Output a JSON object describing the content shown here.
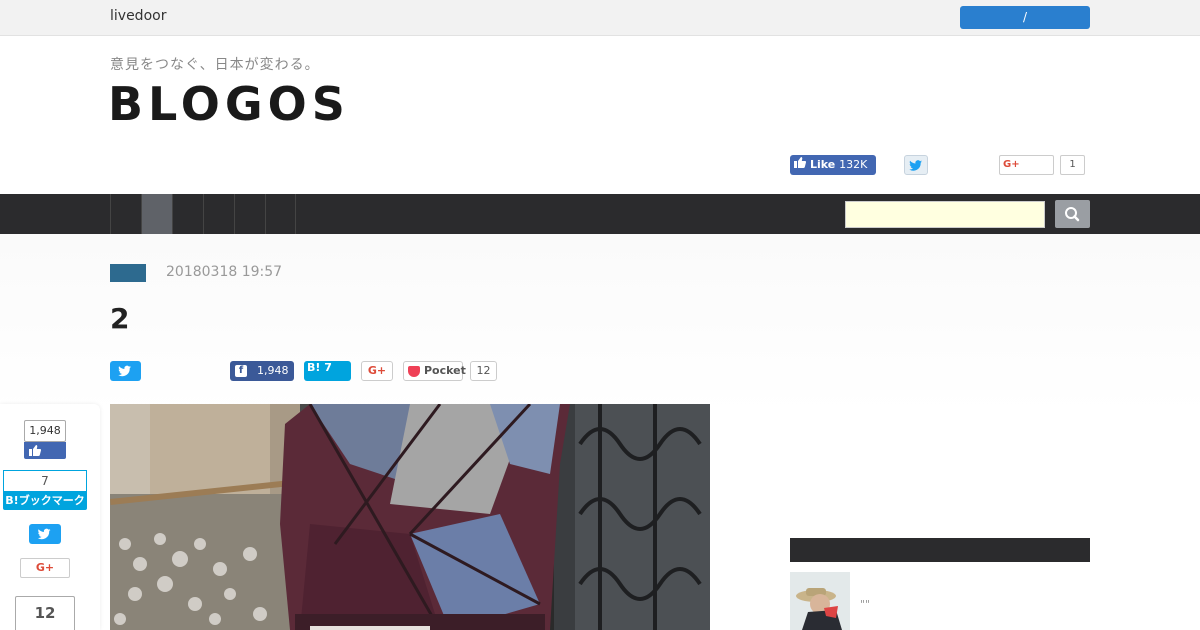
{
  "topbar": {
    "brand": "livedoor",
    "login_label": "/"
  },
  "header": {
    "tagline": "意見をつなぐ、日本が変わる。",
    "logo": "BLOGOS",
    "fb_like_label": "Like",
    "fb_like_count": "132K",
    "gplus_label": "G+",
    "gplus_count": "1"
  },
  "nav": {
    "items": [
      "",
      "",
      "",
      "",
      "",
      ""
    ],
    "active_index": 1
  },
  "search": {
    "placeholder": "",
    "button_icon": "search-icon"
  },
  "article": {
    "date": "20180318 19:57",
    "title": "2",
    "share": {
      "facebook_count": "1,948",
      "hatena_label": "B!",
      "hatena_count": "7",
      "gplus_label": "G+",
      "pocket_label": "Pocket",
      "pocket_count": "12"
    }
  },
  "floating_share": {
    "facebook_count": "1,948",
    "hatena_count": "7",
    "hatena_label": "B!ブックマーク",
    "gplus_label": "G+",
    "pocket_count": "12"
  },
  "sidebar": {
    "item_text": "\"\""
  },
  "colors": {
    "nav_bg": "#2b2b2d",
    "nav_active": "#5f6268",
    "login_blue": "#2a7fcf",
    "facebook": "#4267b2",
    "twitter": "#1da1f2",
    "hatena": "#00a4de",
    "category": "#2d6a8f",
    "search_field": "#ffffe0"
  }
}
